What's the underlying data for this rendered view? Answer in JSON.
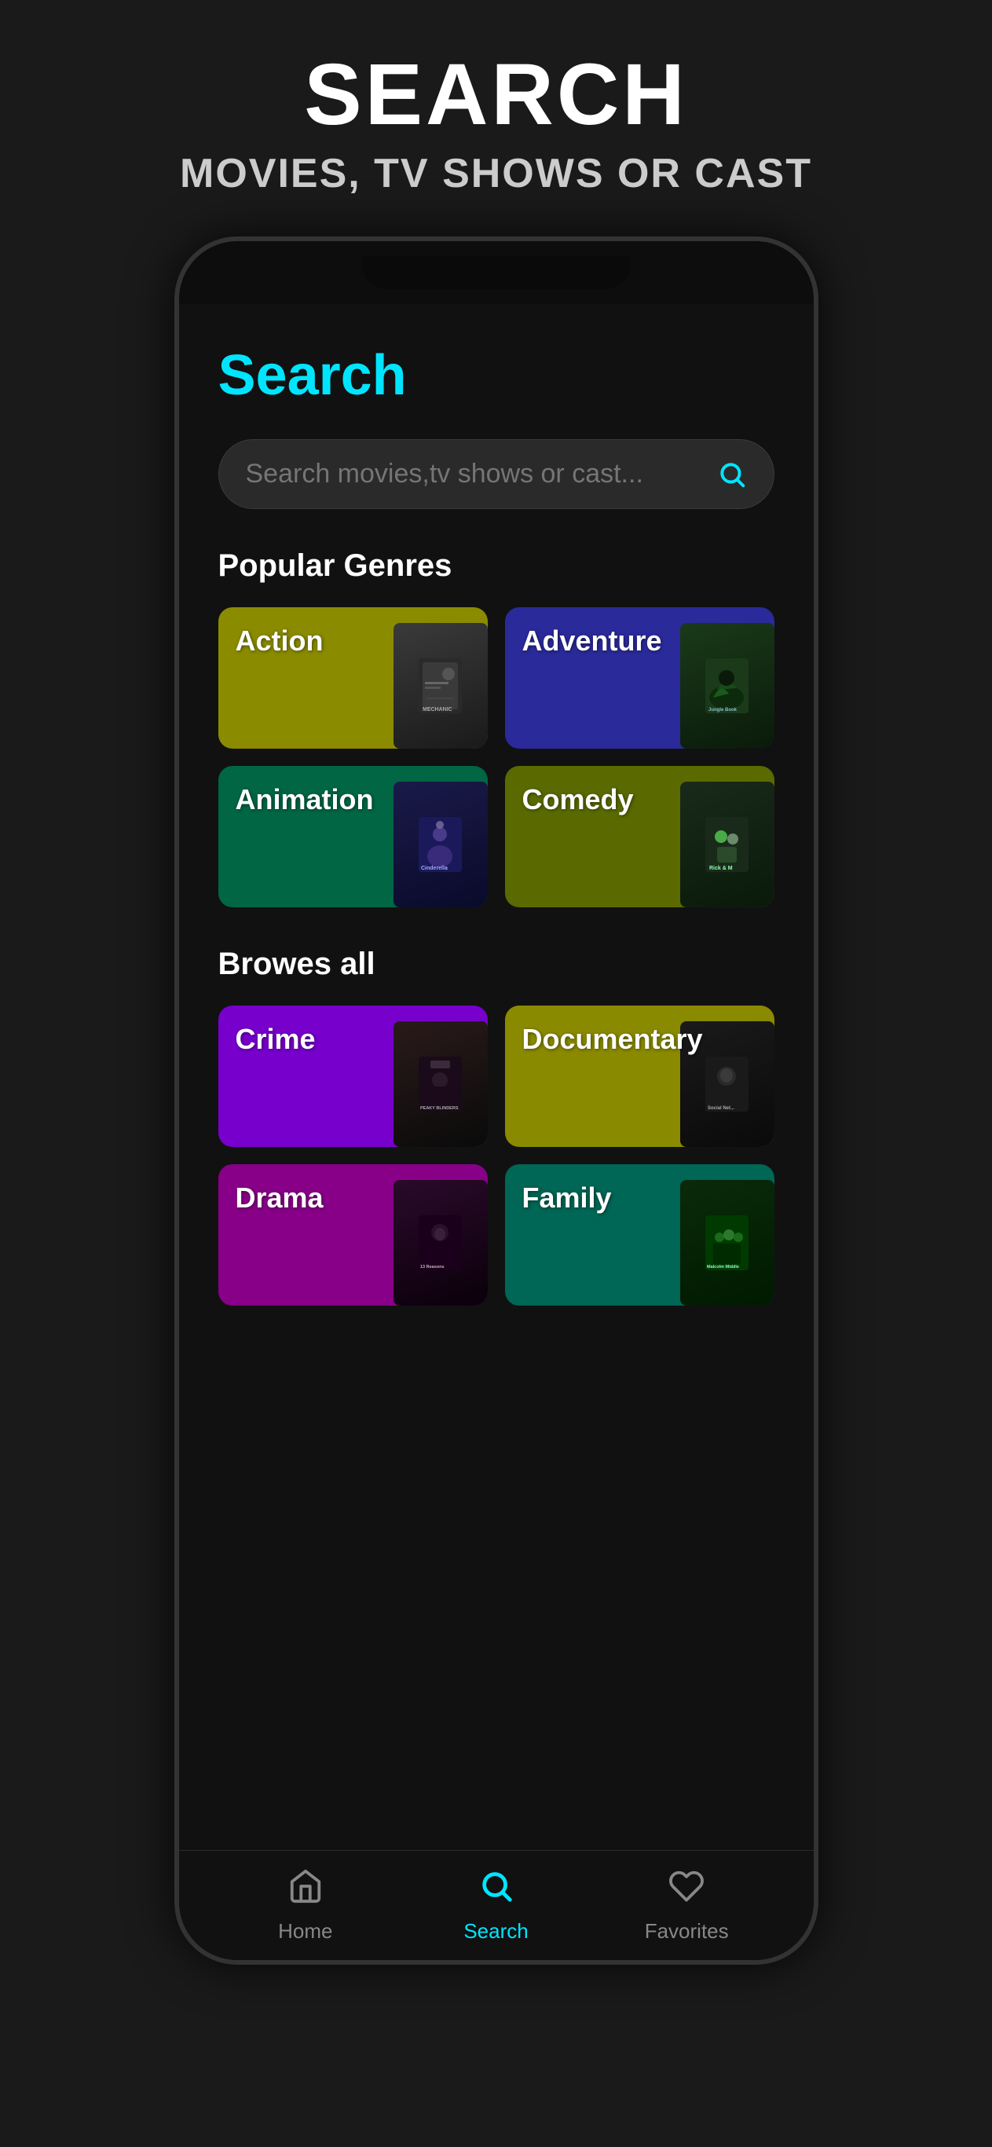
{
  "header": {
    "main_title": "SEARCH",
    "sub_title": "MOVIES, TV SHOWS OR CAST"
  },
  "page": {
    "title": "Search",
    "search_placeholder": "Search movies,tv shows or cast..."
  },
  "sections": {
    "popular_genres_label": "Popular Genres",
    "browse_all_label": "Browes all"
  },
  "popular_genres": [
    {
      "id": "action",
      "label": "Action",
      "color": "card-action",
      "poster": "poster-mechanic",
      "poster_text": "MECHANIC"
    },
    {
      "id": "adventure",
      "label": "Adventure",
      "color": "card-adventure",
      "poster": "poster-jungle",
      "poster_text": "Jungle Book"
    },
    {
      "id": "animation",
      "label": "Animation",
      "color": "card-animation",
      "poster": "poster-cinderella",
      "poster_text": "Cinderella"
    },
    {
      "id": "comedy",
      "label": "Comedy",
      "color": "card-comedy",
      "poster": "poster-rick",
      "poster_text": "Rick & M"
    }
  ],
  "browse_all_genres": [
    {
      "id": "crime",
      "label": "Crime",
      "color": "card-crime",
      "poster": "poster-peaky",
      "poster_text": "PEAKY BLINDERS"
    },
    {
      "id": "documentary",
      "label": "Documentary",
      "color": "card-documentary",
      "poster": "poster-social",
      "poster_text": "Social Network"
    },
    {
      "id": "drama",
      "label": "Drama",
      "color": "card-drama",
      "poster": "poster-drama-show",
      "poster_text": "13 Reasons"
    },
    {
      "id": "family",
      "label": "Family",
      "color": "card-family",
      "poster": "poster-malcolm",
      "poster_text": "Malcolm Middle"
    }
  ],
  "bottom_nav": [
    {
      "id": "home",
      "label": "Home",
      "icon": "⌂",
      "active": false
    },
    {
      "id": "search",
      "label": "Search",
      "icon": "🔍",
      "active": true
    },
    {
      "id": "favorites",
      "label": "Favorites",
      "icon": "♡",
      "active": false
    }
  ]
}
